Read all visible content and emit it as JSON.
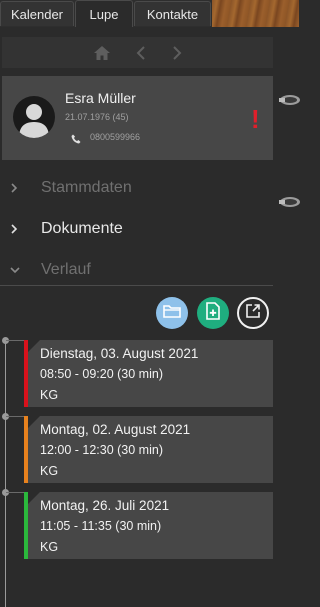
{
  "tabs": [
    {
      "label": "Kalender"
    },
    {
      "label": "Lupe",
      "active": true
    },
    {
      "label": "Kontakte"
    }
  ],
  "nav": {
    "home_icon": "home-icon",
    "back_icon": "chevron-left-icon",
    "forward_icon": "chevron-right-icon"
  },
  "patient": {
    "name": "Esra Müller",
    "dob": "21.07.1976 (45)",
    "phone": "0800599966",
    "alert": "!"
  },
  "sections": [
    {
      "label": "Stammdaten",
      "expanded": false
    },
    {
      "label": "Dokumente",
      "expanded": false
    },
    {
      "label": "Verlauf",
      "expanded": true
    }
  ],
  "actions": [
    {
      "icon": "folder-icon",
      "color": "#8ec1ea"
    },
    {
      "icon": "add-document-icon",
      "color": "#1fae7f"
    },
    {
      "icon": "export-icon",
      "color": "#f0f0f0"
    }
  ],
  "timeline": [
    {
      "date": "Dienstag, 03. August 2021",
      "time": "08:50 - 09:20 (30 min)",
      "type": "KG",
      "color": "#d9121c"
    },
    {
      "date": "Montag, 02. August 2021",
      "time": "12:00 - 12:30 (30 min)",
      "type": "KG",
      "color": "#e8821e"
    },
    {
      "date": "Montag, 26. Juli 2021",
      "time": "11:05 - 11:35 (30 min)",
      "type": "KG",
      "color": "#2bb83c"
    }
  ]
}
